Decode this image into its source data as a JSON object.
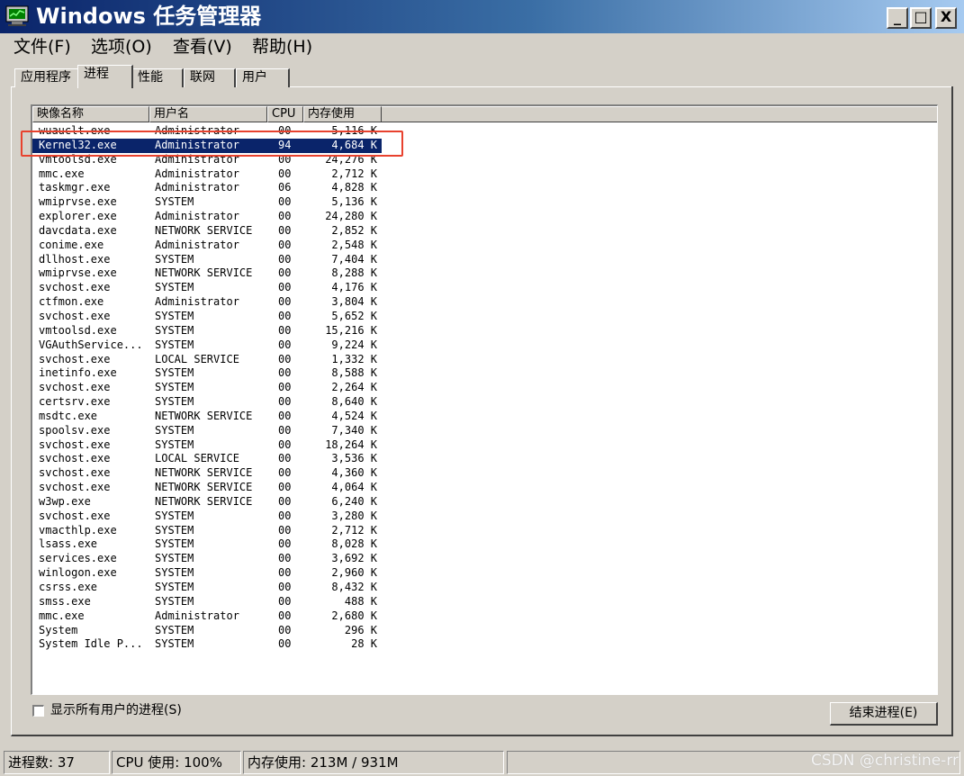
{
  "window": {
    "title": "Windows 任务管理器"
  },
  "window_buttons": {
    "minimize": "_",
    "maximize": "□",
    "close": "X"
  },
  "menu": [
    {
      "label": "文件(F)"
    },
    {
      "label": "选项(O)"
    },
    {
      "label": "查看(V)"
    },
    {
      "label": "帮助(H)"
    }
  ],
  "tabs": [
    {
      "label": "应用程序"
    },
    {
      "label": "进程",
      "active": true
    },
    {
      "label": "性能"
    },
    {
      "label": "联网"
    },
    {
      "label": "用户"
    }
  ],
  "columns": [
    "映像名称",
    "用户名",
    "CPU",
    "内存使用"
  ],
  "processes": [
    {
      "name": "wuauclt.exe",
      "user": "Administrator",
      "cpu": "00",
      "mem": "5,116 K"
    },
    {
      "name": "Kernel32.exe",
      "user": "Administrator",
      "cpu": "94",
      "mem": "4,684 K",
      "selected": true
    },
    {
      "name": "vmtoolsd.exe",
      "user": "Administrator",
      "cpu": "00",
      "mem": "24,276 K"
    },
    {
      "name": "mmc.exe",
      "user": "Administrator",
      "cpu": "00",
      "mem": "2,712 K"
    },
    {
      "name": "taskmgr.exe",
      "user": "Administrator",
      "cpu": "06",
      "mem": "4,828 K"
    },
    {
      "name": "wmiprvse.exe",
      "user": "SYSTEM",
      "cpu": "00",
      "mem": "5,136 K"
    },
    {
      "name": "explorer.exe",
      "user": "Administrator",
      "cpu": "00",
      "mem": "24,280 K"
    },
    {
      "name": "davcdata.exe",
      "user": "NETWORK SERVICE",
      "cpu": "00",
      "mem": "2,852 K"
    },
    {
      "name": "conime.exe",
      "user": "Administrator",
      "cpu": "00",
      "mem": "2,548 K"
    },
    {
      "name": "dllhost.exe",
      "user": "SYSTEM",
      "cpu": "00",
      "mem": "7,404 K"
    },
    {
      "name": "wmiprvse.exe",
      "user": "NETWORK SERVICE",
      "cpu": "00",
      "mem": "8,288 K"
    },
    {
      "name": "svchost.exe",
      "user": "SYSTEM",
      "cpu": "00",
      "mem": "4,176 K"
    },
    {
      "name": "ctfmon.exe",
      "user": "Administrator",
      "cpu": "00",
      "mem": "3,804 K"
    },
    {
      "name": "svchost.exe",
      "user": "SYSTEM",
      "cpu": "00",
      "mem": "5,652 K"
    },
    {
      "name": "vmtoolsd.exe",
      "user": "SYSTEM",
      "cpu": "00",
      "mem": "15,216 K"
    },
    {
      "name": "VGAuthService...",
      "user": "SYSTEM",
      "cpu": "00",
      "mem": "9,224 K"
    },
    {
      "name": "svchost.exe",
      "user": "LOCAL SERVICE",
      "cpu": "00",
      "mem": "1,332 K"
    },
    {
      "name": "inetinfo.exe",
      "user": "SYSTEM",
      "cpu": "00",
      "mem": "8,588 K"
    },
    {
      "name": "svchost.exe",
      "user": "SYSTEM",
      "cpu": "00",
      "mem": "2,264 K"
    },
    {
      "name": "certsrv.exe",
      "user": "SYSTEM",
      "cpu": "00",
      "mem": "8,640 K"
    },
    {
      "name": "msdtc.exe",
      "user": "NETWORK SERVICE",
      "cpu": "00",
      "mem": "4,524 K"
    },
    {
      "name": "spoolsv.exe",
      "user": "SYSTEM",
      "cpu": "00",
      "mem": "7,340 K"
    },
    {
      "name": "svchost.exe",
      "user": "SYSTEM",
      "cpu": "00",
      "mem": "18,264 K"
    },
    {
      "name": "svchost.exe",
      "user": "LOCAL SERVICE",
      "cpu": "00",
      "mem": "3,536 K"
    },
    {
      "name": "svchost.exe",
      "user": "NETWORK SERVICE",
      "cpu": "00",
      "mem": "4,360 K"
    },
    {
      "name": "svchost.exe",
      "user": "NETWORK SERVICE",
      "cpu": "00",
      "mem": "4,064 K"
    },
    {
      "name": "w3wp.exe",
      "user": "NETWORK SERVICE",
      "cpu": "00",
      "mem": "6,240 K"
    },
    {
      "name": "svchost.exe",
      "user": "SYSTEM",
      "cpu": "00",
      "mem": "3,280 K"
    },
    {
      "name": "vmacthlp.exe",
      "user": "SYSTEM",
      "cpu": "00",
      "mem": "2,712 K"
    },
    {
      "name": "lsass.exe",
      "user": "SYSTEM",
      "cpu": "00",
      "mem": "8,028 K"
    },
    {
      "name": "services.exe",
      "user": "SYSTEM",
      "cpu": "00",
      "mem": "3,692 K"
    },
    {
      "name": "winlogon.exe",
      "user": "SYSTEM",
      "cpu": "00",
      "mem": "2,960 K"
    },
    {
      "name": "csrss.exe",
      "user": "SYSTEM",
      "cpu": "00",
      "mem": "8,432 K"
    },
    {
      "name": "smss.exe",
      "user": "SYSTEM",
      "cpu": "00",
      "mem": "488 K"
    },
    {
      "name": "mmc.exe",
      "user": "Administrator",
      "cpu": "00",
      "mem": "2,680 K"
    },
    {
      "name": "System",
      "user": "SYSTEM",
      "cpu": "00",
      "mem": "296 K"
    },
    {
      "name": "System Idle P...",
      "user": "SYSTEM",
      "cpu": "00",
      "mem": "28 K"
    }
  ],
  "show_all_users": {
    "label": "显示所有用户的进程(S)",
    "checked": false
  },
  "end_process_button": "结束进程(E)",
  "statusbar": {
    "processes": "进程数: 37",
    "cpu": "CPU 使用: 100%",
    "memory": "内存使用: 213M / 931M"
  },
  "watermark": "CSDN @christine-rr",
  "colors": {
    "title_gradient_start": "#0a246a",
    "title_gradient_end": "#a6caf0",
    "selection": "#0a246a",
    "highlight_outline": "#e8422e",
    "face": "#d4d0c8"
  }
}
